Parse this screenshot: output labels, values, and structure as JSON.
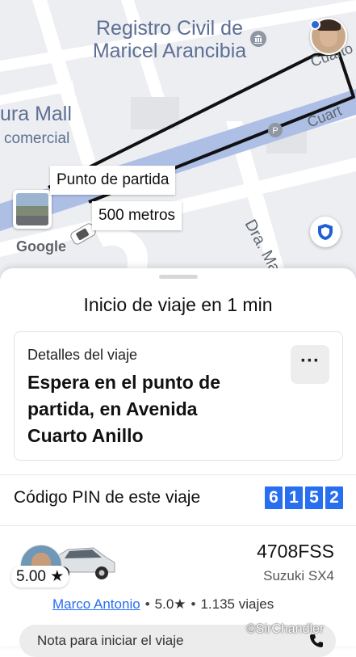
{
  "map": {
    "poi_title_line1": "Registro Civil de",
    "poi_title_line2": "Maricel Arancibia",
    "poi_mall": "ura Mall",
    "poi_comercial": "comercial",
    "street_dra": "Dra. Mar",
    "street_cuarto_1": "Cuarto",
    "street_cuarto_2": "Cuart",
    "pickup_tag": "Punto de partida",
    "distance_tag": "500 metros",
    "google_logo": "Google",
    "icons": {
      "shield": "shield-icon",
      "bank": "bank-icon",
      "parking": "parking-icon"
    },
    "route_color": "#111111",
    "road_highlight_color": "#aebfe6"
  },
  "sheet": {
    "heading": "Inicio de viaje en 1 min",
    "details": {
      "label": "Detalles del viaje",
      "text": "Espera en el punto de partida, en Avenida Cuarto Anillo",
      "more_label": "···"
    },
    "pin": {
      "label": "Código PIN de este viaje",
      "digits": [
        "6",
        "1",
        "5",
        "2"
      ],
      "color": "#276ef1"
    },
    "driver": {
      "rating_badge": "5.00 ★",
      "plate": "4708FSS",
      "car_model": "Suzuki SX4",
      "name": "Marco Antonio",
      "rating": "5.0★",
      "trips": "1.135 viajes"
    },
    "note_placeholder": "Nota para iniciar el viaje"
  },
  "watermark": "©SirChandler"
}
